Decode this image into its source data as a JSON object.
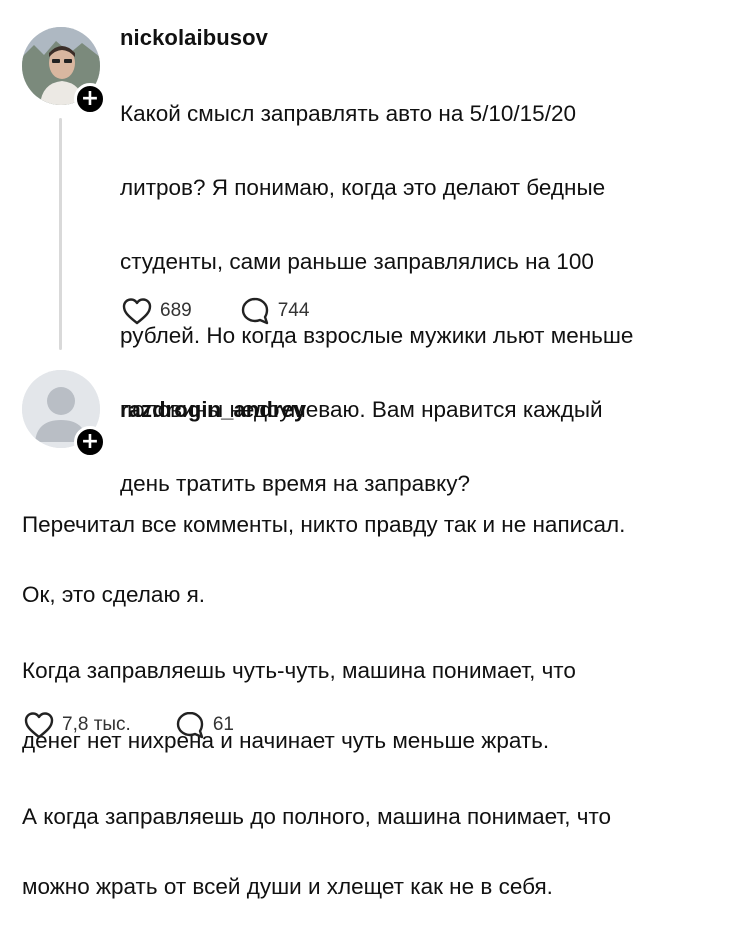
{
  "post": {
    "username": "nickolaibusov",
    "text_lines": [
      "Какой смысл заправлять авто на 5/10/15/20",
      "литров? Я понимаю, когда это делают бедные",
      "студенты, сами раньше заправлялись на 100",
      "рублей. Но когда взрослые мужики льют меньше",
      "половины недоумеваю. Вам нравится каждый",
      "день тратить время на заправку?"
    ],
    "likes": "689",
    "comments": "744"
  },
  "reply": {
    "username": "razdrogin_andrey",
    "paragraphs": [
      [
        "Перечитал все комменты, никто правду так и не написал.",
        "Ок, это сделаю я."
      ],
      [
        "Когда заправляешь чуть-чуть, машина понимает, что",
        "денег нет нихрена и начинает чуть меньше жрать."
      ],
      [
        "А когда заправляешь до полного, машина понимает, что",
        "можно жрать от всей души и хлещет как не в себя."
      ]
    ],
    "likes": "7,8 тыс.",
    "comments": "61"
  },
  "icons": {
    "like": "heart-outline-icon",
    "comment": "speech-bubble-icon",
    "follow": "plus-icon"
  },
  "colors": {
    "text": "#111111",
    "muted": "#333333",
    "thread_line": "#d9d9d9"
  }
}
